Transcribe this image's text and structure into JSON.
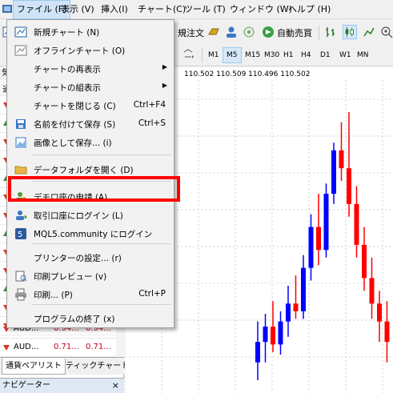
{
  "menubar": {
    "items": [
      "ファイル (F)",
      "表示 (V)",
      "挿入(I)",
      "チャート(C)",
      "ツール (T)",
      "ウィンドウ (W)",
      "ヘルプ (H)"
    ]
  },
  "toolbar": {
    "new_order_label": "規注文",
    "auto_trade_label": "自動売買",
    "timeframes": [
      "M1",
      "M5",
      "M15",
      "M30",
      "H1",
      "H4",
      "D1",
      "W1",
      "MN"
    ],
    "active_timeframe": "M5"
  },
  "left_panel": {
    "header": "気",
    "col_header": "通",
    "rows": [
      {
        "symbol": "AUD...",
        "bid": "0.94...",
        "ask": "0.94...",
        "direction": "down"
      },
      {
        "symbol": "AUD...",
        "bid": "0.71...",
        "ask": "0.71...",
        "direction": "down"
      }
    ],
    "tabs": [
      "通貨ペアリスト",
      "ティックチャート"
    ],
    "navigator_title": "ナビゲーター",
    "navigator_close": "×"
  },
  "chart": {
    "price_readout": "110.502 110.509 110.496 110.502",
    "candles": [
      {
        "o": 110.462,
        "h": 110.478,
        "l": 110.455,
        "c": 110.47
      },
      {
        "o": 110.47,
        "h": 110.481,
        "l": 110.462,
        "c": 110.476
      },
      {
        "o": 110.476,
        "h": 110.486,
        "l": 110.466,
        "c": 110.469
      },
      {
        "o": 110.469,
        "h": 110.482,
        "l": 110.465,
        "c": 110.478
      },
      {
        "o": 110.478,
        "h": 110.492,
        "l": 110.472,
        "c": 110.485
      },
      {
        "o": 110.485,
        "h": 110.496,
        "l": 110.479,
        "c": 110.482
      },
      {
        "o": 110.482,
        "h": 110.504,
        "l": 110.479,
        "c": 110.499
      },
      {
        "o": 110.499,
        "h": 110.52,
        "l": 110.494,
        "c": 110.515
      },
      {
        "o": 110.515,
        "h": 110.528,
        "l": 110.5,
        "c": 110.506
      },
      {
        "o": 110.506,
        "h": 110.532,
        "l": 110.503,
        "c": 110.528
      },
      {
        "o": 110.528,
        "h": 110.548,
        "l": 110.524,
        "c": 110.545
      },
      {
        "o": 110.545,
        "h": 110.556,
        "l": 110.533,
        "c": 110.538
      },
      {
        "o": 110.538,
        "h": 110.56,
        "l": 110.519,
        "c": 110.524
      },
      {
        "o": 110.524,
        "h": 110.531,
        "l": 110.503,
        "c": 110.508
      },
      {
        "o": 110.508,
        "h": 110.515,
        "l": 110.49,
        "c": 110.495
      },
      {
        "o": 110.495,
        "h": 110.503,
        "l": 110.479,
        "c": 110.485
      },
      {
        "o": 110.485,
        "h": 110.49,
        "l": 110.47,
        "c": 110.478
      },
      {
        "o": 110.478,
        "h": 110.486,
        "l": 110.462,
        "c": 110.47
      }
    ],
    "colors": {
      "bull": "#0000ff",
      "bear": "#ff0000",
      "grid": "#c8d0dc"
    }
  },
  "dropdown": {
    "items": [
      {
        "label": "新規チャート (N)",
        "shortcut": "",
        "submenu": false,
        "icon": "new-chart-icon"
      },
      {
        "label": "オフラインチャート (O)",
        "shortcut": "",
        "submenu": false,
        "icon": "offline-chart-icon"
      },
      {
        "label": "チャートの再表示",
        "shortcut": "",
        "submenu": true,
        "icon": ""
      },
      {
        "label": "チャートの組表示",
        "shortcut": "",
        "submenu": true,
        "icon": ""
      },
      {
        "label": "チャートを閉じる (C)",
        "shortcut": "Ctrl+F4",
        "submenu": false,
        "icon": ""
      },
      {
        "label": "名前を付けて保存 (S)",
        "shortcut": "Ctrl+S",
        "submenu": false,
        "icon": "save-icon"
      },
      {
        "label": "画像として保存... (i)",
        "shortcut": "",
        "submenu": false,
        "icon": "save-picture-icon"
      },
      {
        "label": "データフォルダを開く (D)",
        "shortcut": "",
        "submenu": false,
        "icon": "folder-icon"
      },
      {
        "label": "デモ口座の申請 (A)",
        "shortcut": "",
        "submenu": false,
        "icon": "demo-account-icon"
      },
      {
        "label": "取引口座にログイン (L)",
        "shortcut": "",
        "submenu": false,
        "icon": "trade-login-icon"
      },
      {
        "label": "MQL5.community にログイン",
        "shortcut": "",
        "submenu": false,
        "icon": "mql5-icon"
      },
      {
        "label": "プリンターの設定... (r)",
        "shortcut": "",
        "submenu": false,
        "icon": ""
      },
      {
        "label": "印刷プレビュー (v)",
        "shortcut": "",
        "submenu": false,
        "icon": "print-preview-icon"
      },
      {
        "label": "印刷... (P)",
        "shortcut": "Ctrl+P",
        "submenu": false,
        "icon": "print-icon"
      },
      {
        "label": "プログラムの終了 (x)",
        "shortcut": "",
        "submenu": false,
        "icon": ""
      }
    ],
    "highlight_color": "#ff0000"
  }
}
